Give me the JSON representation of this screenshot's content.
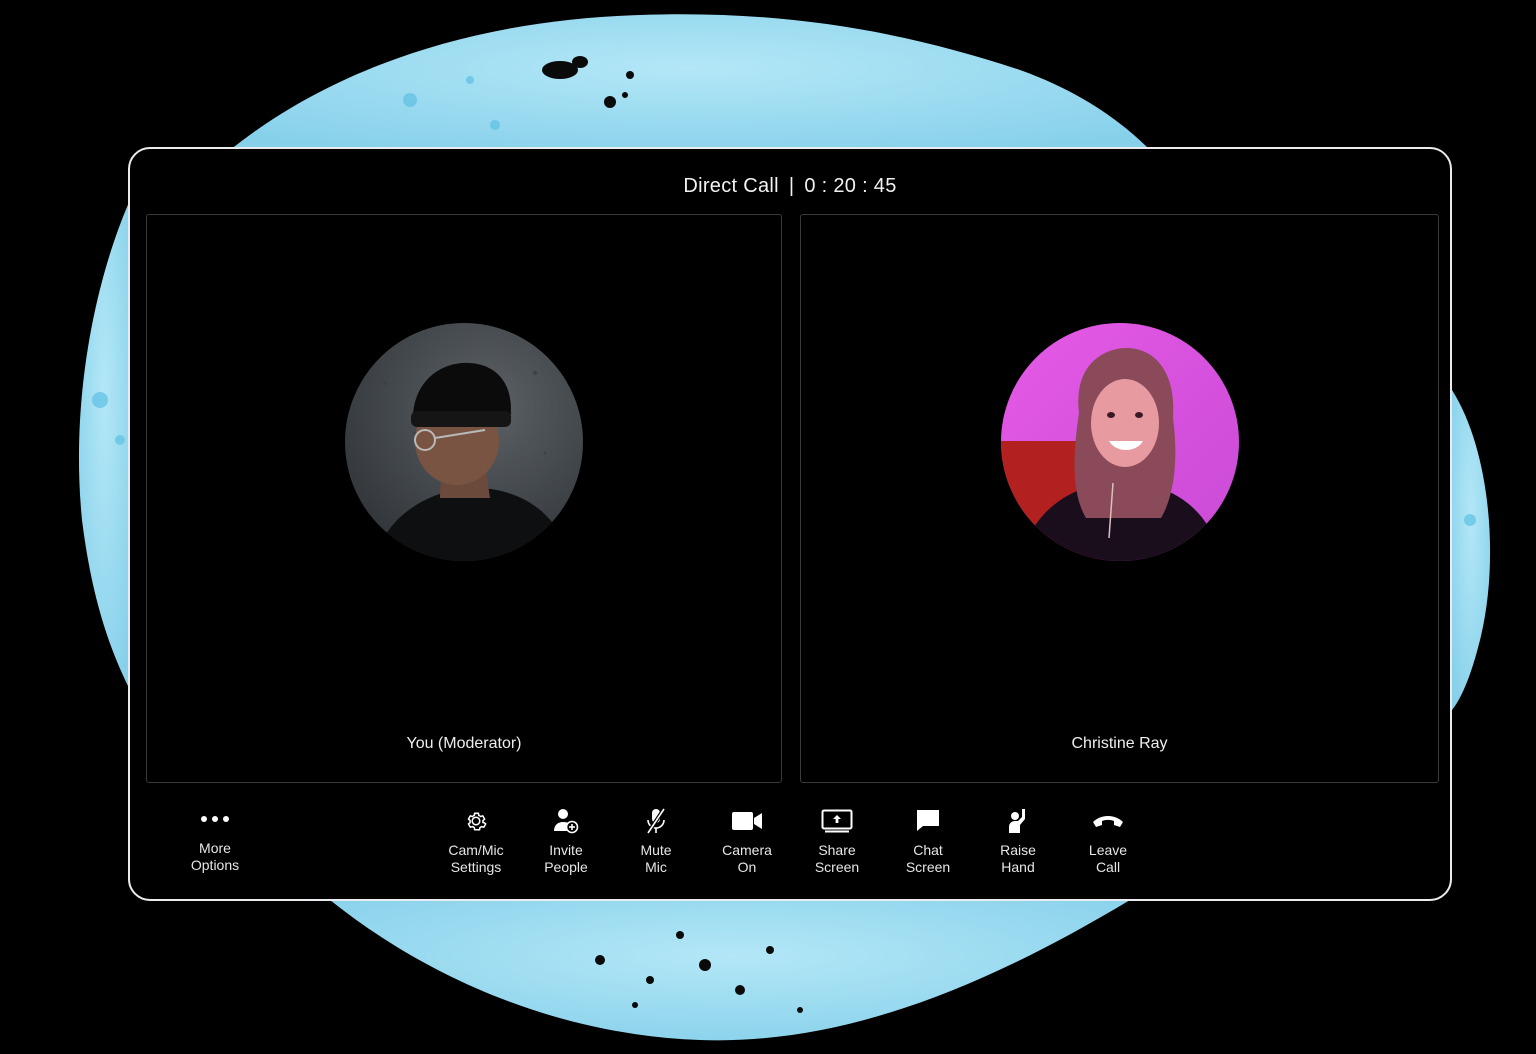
{
  "header": {
    "call_type": "Direct Call",
    "separator": "|",
    "timer": "0 : 20 : 45"
  },
  "participants": [
    {
      "name": "You (Moderator)",
      "avatar": "man-in-beanie-photo"
    },
    {
      "name": "Christine Ray",
      "avatar": "smiling-woman-pink-light-photo"
    }
  ],
  "controls": {
    "more": {
      "line1": "More",
      "line2": "Options",
      "icon": "more-dots-icon"
    },
    "settings": {
      "line1": "Cam/Mic",
      "line2": "Settings",
      "icon": "gear-icon"
    },
    "invite": {
      "line1": "Invite",
      "line2": "People",
      "icon": "add-person-icon"
    },
    "mute": {
      "line1": "Mute",
      "line2": "Mic",
      "icon": "mic-off-icon"
    },
    "camera": {
      "line1": "Camera",
      "line2": "On",
      "icon": "video-camera-icon"
    },
    "share": {
      "line1": "Share",
      "line2": "Screen",
      "icon": "share-screen-icon"
    },
    "chat": {
      "line1": "Chat",
      "line2": "Screen",
      "icon": "chat-bubble-icon"
    },
    "raise": {
      "line1": "Raise",
      "line2": "Hand",
      "icon": "raise-hand-icon"
    },
    "leave": {
      "line1": "Leave",
      "line2": "Call",
      "icon": "phone-hangup-icon"
    }
  },
  "colors": {
    "backdrop_blob": "#8fd6ef",
    "window_border": "#e9ecef",
    "window_bg": "#000000"
  }
}
